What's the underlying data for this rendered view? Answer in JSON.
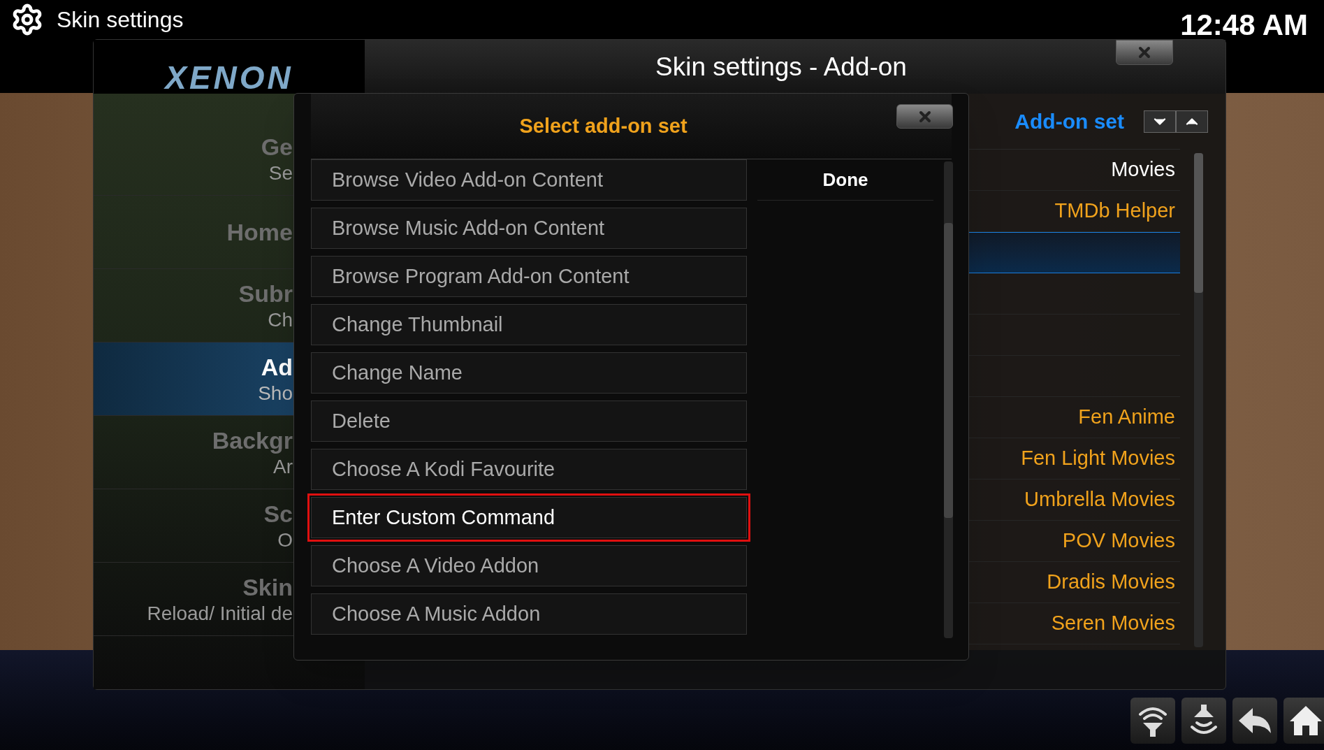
{
  "top_bar": {
    "title": "Skin settings",
    "clock": "12:48 AM"
  },
  "window": {
    "logo": "XENON",
    "title": "Skin settings - Add-on"
  },
  "sidebar": {
    "items": [
      {
        "title": "Ge",
        "subtitle": "Se",
        "selected": false
      },
      {
        "title": "Home",
        "selected": false
      },
      {
        "title": "Subr",
        "subtitle": "Ch",
        "selected": false
      },
      {
        "title": "Ad",
        "subtitle": "Sho",
        "selected": true
      },
      {
        "title": "Backgr",
        "subtitle": "Ar",
        "selected": false
      },
      {
        "title": "Sc",
        "subtitle": "O",
        "selected": false
      },
      {
        "title": "Skin",
        "subtitle": "Reload/ Initial de",
        "selected": false
      }
    ]
  },
  "list": {
    "header": "Add-on set",
    "rows": [
      {
        "kind": "category",
        "label": "Movies",
        "selected": false
      },
      {
        "kind": "addon",
        "label": "TMDb Helper",
        "selected": false
      },
      {
        "kind": "empty",
        "selected": true
      },
      {
        "kind": "empty",
        "selected": false
      },
      {
        "kind": "empty",
        "selected": false
      },
      {
        "kind": "empty",
        "selected": false
      },
      {
        "kind": "addon",
        "label": "Fen Anime",
        "selected": false
      },
      {
        "kind": "addon",
        "label": "Fen Light Movies",
        "selected": false
      },
      {
        "kind": "addon",
        "label": "Umbrella Movies",
        "selected": false
      },
      {
        "kind": "addon",
        "label": "POV Movies",
        "selected": false
      },
      {
        "kind": "addon",
        "label": "Dradis Movies",
        "selected": false
      },
      {
        "kind": "addon",
        "label": "Seren Movies",
        "selected": false
      }
    ]
  },
  "dialog": {
    "title": "Select add-on set",
    "done": "Done",
    "items": [
      {
        "label": "Browse Video Add-on Content",
        "selected": false
      },
      {
        "label": "Browse Music Add-on Content",
        "selected": false
      },
      {
        "label": "Browse Program Add-on Content",
        "selected": false
      },
      {
        "label": "Change Thumbnail",
        "selected": false
      },
      {
        "label": "Change Name",
        "selected": false
      },
      {
        "label": "Delete",
        "selected": false
      },
      {
        "label": "Choose A Kodi Favourite",
        "selected": false
      },
      {
        "label": "Enter Custom Command",
        "selected": true
      },
      {
        "label": "Choose A Video Addon",
        "selected": false
      },
      {
        "label": "Choose A Music Addon",
        "selected": false
      }
    ]
  }
}
